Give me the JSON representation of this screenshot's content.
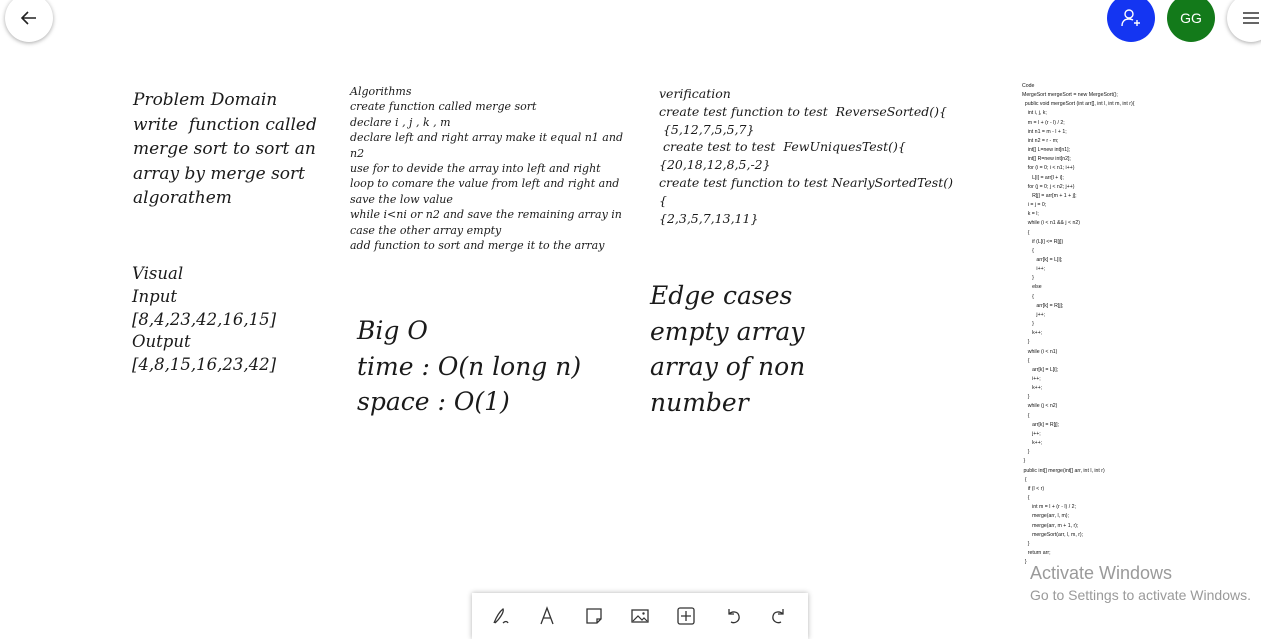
{
  "header": {
    "avatar_initials": "GG",
    "back_icon": "arrow-left-icon",
    "share_icon": "add-person-icon",
    "menu_icon": "hamburger-menu-icon",
    "share_color": "#1435f2",
    "avatar_color": "#137a1a"
  },
  "canvas": {
    "problem": [
      "Problem Domain",
      "write  function called",
      "merge sort to sort an",
      "array by merge sort",
      "algorathem"
    ],
    "algorithms": [
      "Algorithms",
      "create function called merge sort",
      "declare i , j , k , m",
      "declare left and right array make it equal n1 and",
      "n2",
      "use for to devide the array into left and right",
      "loop to comare the value from left and right and",
      "save the low value",
      "while i<ni or n2 and save the remaining array in",
      "case the other array empty",
      "add function to sort and merge it to the array"
    ],
    "verification": [
      "verification",
      "create test function to test  ReverseSorted(){",
      " {5,12,7,5,5,7}",
      " create test to test  FewUniquesTest(){",
      "{20,18,12,8,5,-2}",
      "create test function to test NearlySortedTest()",
      "{",
      "{2,3,5,7,13,11}"
    ],
    "code": [
      "Code",
      "MergeSort mergeSort = new MergeSort();",
      "  public void mergeSort (int arr[], int l, int m, int r){",
      "    int i, j, k;",
      "    m = l + (r - l) / 2;",
      "    int n1 = m - l + 1;",
      "    int n2 = r - m;",
      "    int[] L=new int[n1];",
      "    int[] R=new int[n2];",
      "    for (i = 0; i < n1; i++)",
      "       L[i] = arr[l + i];",
      "    for (j = 0; j < n2; j++)",
      "       R[j] = arr[m + 1 + j];",
      "    i = j = 0;",
      "    k = l;",
      "    while (i < n1 && j < n2)",
      "    {",
      "       if (L[i] <= R[j])",
      "       {",
      "          arr[k] = L[i];",
      "          i++;",
      "       }",
      "       else",
      "       {",
      "          arr[k] = R[j];",
      "          j++;",
      "       }",
      "       k++;",
      "    }",
      "    while (i < n1)",
      "    {",
      "       arr[k] = L[i];",
      "       i++;",
      "       k++;",
      "    }",
      "    while (j < n2)",
      "    {",
      "       arr[k] = R[j];",
      "       j++;",
      "       k++;",
      "    }",
      " }",
      " public int[] merge(int[] arr, int l, int r)",
      "  {",
      "    if (l < r)",
      "    {",
      "       int m = l + (r - l) / 2;",
      "       merge(arr, l, m);",
      "       merge(arr, m + 1, r);",
      "       mergeSort(arr, l, m, r);",
      "    }",
      "    return arr;",
      "  }"
    ],
    "visual": [
      "Visual",
      "Input",
      "[8,4,23,42,16,15]",
      "Output",
      "[4,8,15,16,23,42]"
    ],
    "bigo": [
      "Big O",
      "time : O(n long n)",
      "space : O(1)"
    ],
    "edge": [
      "Edge cases",
      "empty array",
      "array of non",
      "number"
    ]
  },
  "watermark": {
    "title": "Activate Windows",
    "subtitle": "Go to Settings to activate Windows."
  },
  "toolbar": {
    "tools": [
      "pen-icon",
      "text-icon",
      "sticky-note-icon",
      "image-icon",
      "add-icon",
      "undo-icon",
      "redo-icon"
    ]
  }
}
